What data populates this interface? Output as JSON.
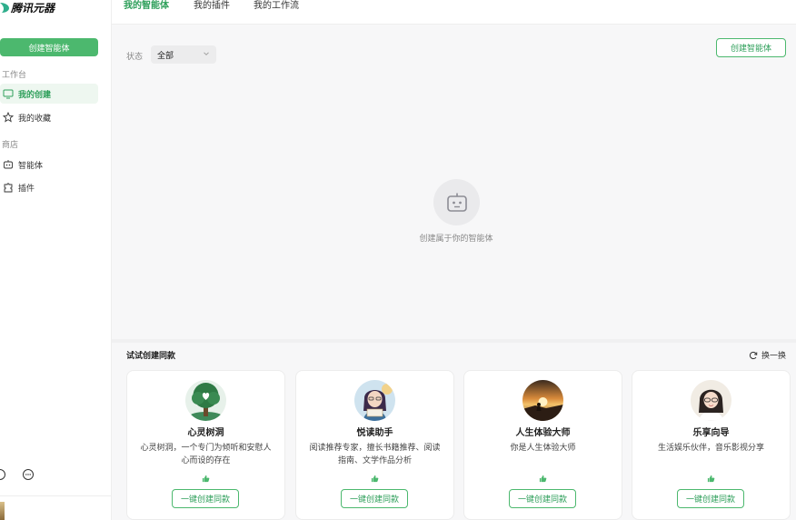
{
  "brand": {
    "name": "腾讯元器"
  },
  "sidebar": {
    "create_label": "创建智能体",
    "workbench_label": "工作台",
    "store_label": "商店",
    "items": [
      {
        "label": "我的创建",
        "icon": "monitor-icon",
        "active": true
      },
      {
        "label": "我的收藏",
        "icon": "star-icon",
        "active": false
      },
      {
        "label": "智能体",
        "icon": "robot-icon",
        "active": false
      },
      {
        "label": "插件",
        "icon": "puzzle-icon",
        "active": false
      }
    ]
  },
  "tabs": [
    {
      "label": "我的智能体",
      "active": true
    },
    {
      "label": "我的插件",
      "active": false
    },
    {
      "label": "我的工作流",
      "active": false
    }
  ],
  "filter": {
    "status_label": "状态",
    "status_value": "全部"
  },
  "main": {
    "create_button": "创建智能体",
    "empty_text": "创建属于你的智能体"
  },
  "try_section": {
    "title": "试试创建同款",
    "swap_label": "换一换",
    "cards": [
      {
        "name": "心灵树洞",
        "desc": "心灵树洞，一个专门为倾听和安慰人心而设的存在",
        "button": "一键创建同款"
      },
      {
        "name": "悦读助手",
        "desc": "阅读推荐专家，擅长书籍推荐、阅读指南、文学作品分析",
        "button": "一键创建同款"
      },
      {
        "name": "人生体验大师",
        "desc": "你是人生体验大师",
        "button": "一键创建同款"
      },
      {
        "name": "乐享向导",
        "desc": "生活娱乐伙伴，音乐影视分享",
        "button": "一键创建同款"
      }
    ]
  },
  "colors": {
    "accent": "#4cb86e",
    "accent_text": "#2e9f5a",
    "panel_bg": "#f7f7f8"
  }
}
